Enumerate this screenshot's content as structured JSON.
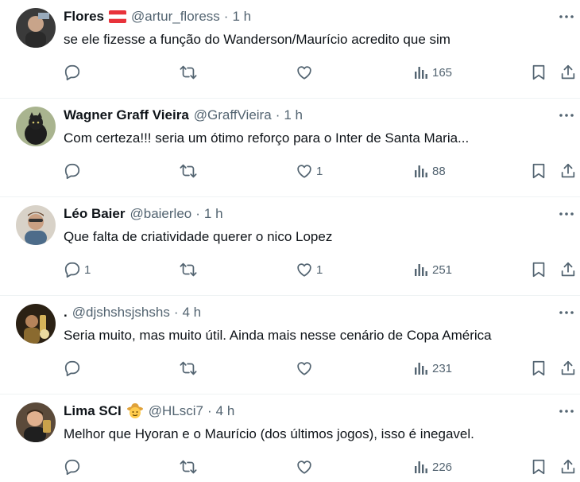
{
  "colors": {
    "text": "#0f1419",
    "secondary": "#536471",
    "divider": "#eff3f4"
  },
  "icons": {
    "reply": "reply-icon",
    "retweet": "retweet-icon",
    "like": "heart-icon",
    "views": "views-icon",
    "bookmark": "bookmark-icon",
    "share": "share-icon",
    "more": "more-icon"
  },
  "tweets": [
    {
      "name": "Flores",
      "flag": "austria-flag",
      "handle": "@artur_floress",
      "time": "1 h",
      "text": "se ele fizesse a função do Wanderson/Maurício acredito que sim",
      "replies": "",
      "retweets": "",
      "likes": "",
      "views": "165"
    },
    {
      "name": "Wagner Graff Vieira",
      "handle": "@GraffVieira",
      "time": "1 h",
      "text": "Com certeza!!! seria um ótimo reforço para o Inter de Santa Maria...",
      "replies": "",
      "retweets": "",
      "likes": "1",
      "views": "88"
    },
    {
      "name": "Léo Baier",
      "handle": "@baierleo",
      "time": "1 h",
      "text": "Que falta de criatividade querer o nico Lopez",
      "replies": "1",
      "retweets": "",
      "likes": "1",
      "views": "251"
    },
    {
      "name": ".",
      "handle": "@djshshsjshshs",
      "time": "4 h",
      "text": "Seria muito, mas muito útil. Ainda mais nesse cenário de Copa América",
      "replies": "",
      "retweets": "",
      "likes": "",
      "views": "231"
    },
    {
      "name": "Lima SCI",
      "emoji": "cowboy-emoji",
      "handle": "@HLsci7",
      "time": "4 h",
      "text": "Melhor que Hyoran e o Maurício (dos últimos jogos), isso é inegavel.",
      "replies": "",
      "retweets": "",
      "likes": "",
      "views": "226"
    }
  ]
}
